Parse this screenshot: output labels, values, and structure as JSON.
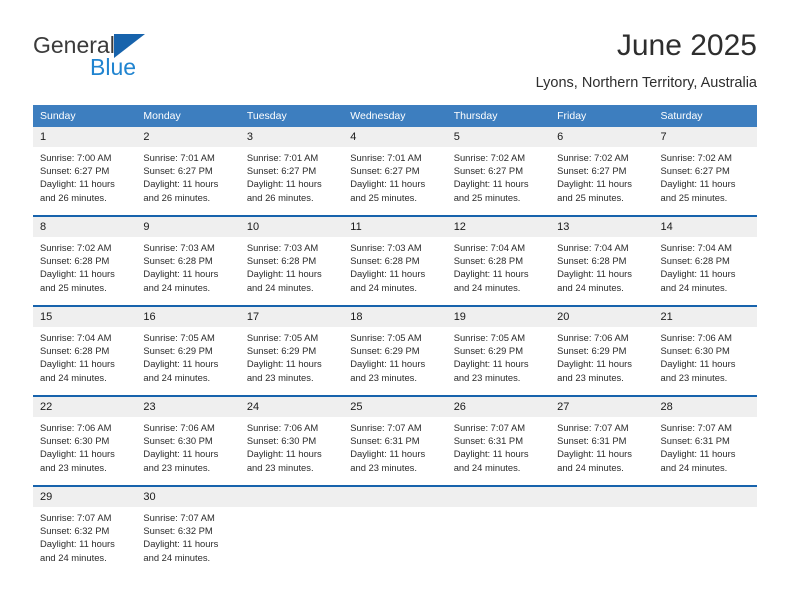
{
  "brand": {
    "name_part1": "General",
    "name_part2": "Blue",
    "logo_icon": "blue-triangle-logo",
    "color_primary": "#1763ac",
    "color_secondary": "#2084d0"
  },
  "header": {
    "title": "June 2025",
    "location": "Lyons, Northern Territory, Australia"
  },
  "calendar": {
    "header_bg": "#3d7ebf",
    "separator_color": "#1763ac",
    "daynum_bg": "#efefef",
    "weekdays": [
      "Sunday",
      "Monday",
      "Tuesday",
      "Wednesday",
      "Thursday",
      "Friday",
      "Saturday"
    ],
    "weeks": [
      [
        {
          "day": "1",
          "sunrise": "Sunrise: 7:00 AM",
          "sunset": "Sunset: 6:27 PM",
          "daylight_line1": "Daylight: 11 hours",
          "daylight_line2": "and 26 minutes."
        },
        {
          "day": "2",
          "sunrise": "Sunrise: 7:01 AM",
          "sunset": "Sunset: 6:27 PM",
          "daylight_line1": "Daylight: 11 hours",
          "daylight_line2": "and 26 minutes."
        },
        {
          "day": "3",
          "sunrise": "Sunrise: 7:01 AM",
          "sunset": "Sunset: 6:27 PM",
          "daylight_line1": "Daylight: 11 hours",
          "daylight_line2": "and 26 minutes."
        },
        {
          "day": "4",
          "sunrise": "Sunrise: 7:01 AM",
          "sunset": "Sunset: 6:27 PM",
          "daylight_line1": "Daylight: 11 hours",
          "daylight_line2": "and 25 minutes."
        },
        {
          "day": "5",
          "sunrise": "Sunrise: 7:02 AM",
          "sunset": "Sunset: 6:27 PM",
          "daylight_line1": "Daylight: 11 hours",
          "daylight_line2": "and 25 minutes."
        },
        {
          "day": "6",
          "sunrise": "Sunrise: 7:02 AM",
          "sunset": "Sunset: 6:27 PM",
          "daylight_line1": "Daylight: 11 hours",
          "daylight_line2": "and 25 minutes."
        },
        {
          "day": "7",
          "sunrise": "Sunrise: 7:02 AM",
          "sunset": "Sunset: 6:27 PM",
          "daylight_line1": "Daylight: 11 hours",
          "daylight_line2": "and 25 minutes."
        }
      ],
      [
        {
          "day": "8",
          "sunrise": "Sunrise: 7:02 AM",
          "sunset": "Sunset: 6:28 PM",
          "daylight_line1": "Daylight: 11 hours",
          "daylight_line2": "and 25 minutes."
        },
        {
          "day": "9",
          "sunrise": "Sunrise: 7:03 AM",
          "sunset": "Sunset: 6:28 PM",
          "daylight_line1": "Daylight: 11 hours",
          "daylight_line2": "and 24 minutes."
        },
        {
          "day": "10",
          "sunrise": "Sunrise: 7:03 AM",
          "sunset": "Sunset: 6:28 PM",
          "daylight_line1": "Daylight: 11 hours",
          "daylight_line2": "and 24 minutes."
        },
        {
          "day": "11",
          "sunrise": "Sunrise: 7:03 AM",
          "sunset": "Sunset: 6:28 PM",
          "daylight_line1": "Daylight: 11 hours",
          "daylight_line2": "and 24 minutes."
        },
        {
          "day": "12",
          "sunrise": "Sunrise: 7:04 AM",
          "sunset": "Sunset: 6:28 PM",
          "daylight_line1": "Daylight: 11 hours",
          "daylight_line2": "and 24 minutes."
        },
        {
          "day": "13",
          "sunrise": "Sunrise: 7:04 AM",
          "sunset": "Sunset: 6:28 PM",
          "daylight_line1": "Daylight: 11 hours",
          "daylight_line2": "and 24 minutes."
        },
        {
          "day": "14",
          "sunrise": "Sunrise: 7:04 AM",
          "sunset": "Sunset: 6:28 PM",
          "daylight_line1": "Daylight: 11 hours",
          "daylight_line2": "and 24 minutes."
        }
      ],
      [
        {
          "day": "15",
          "sunrise": "Sunrise: 7:04 AM",
          "sunset": "Sunset: 6:28 PM",
          "daylight_line1": "Daylight: 11 hours",
          "daylight_line2": "and 24 minutes."
        },
        {
          "day": "16",
          "sunrise": "Sunrise: 7:05 AM",
          "sunset": "Sunset: 6:29 PM",
          "daylight_line1": "Daylight: 11 hours",
          "daylight_line2": "and 24 minutes."
        },
        {
          "day": "17",
          "sunrise": "Sunrise: 7:05 AM",
          "sunset": "Sunset: 6:29 PM",
          "daylight_line1": "Daylight: 11 hours",
          "daylight_line2": "and 23 minutes."
        },
        {
          "day": "18",
          "sunrise": "Sunrise: 7:05 AM",
          "sunset": "Sunset: 6:29 PM",
          "daylight_line1": "Daylight: 11 hours",
          "daylight_line2": "and 23 minutes."
        },
        {
          "day": "19",
          "sunrise": "Sunrise: 7:05 AM",
          "sunset": "Sunset: 6:29 PM",
          "daylight_line1": "Daylight: 11 hours",
          "daylight_line2": "and 23 minutes."
        },
        {
          "day": "20",
          "sunrise": "Sunrise: 7:06 AM",
          "sunset": "Sunset: 6:29 PM",
          "daylight_line1": "Daylight: 11 hours",
          "daylight_line2": "and 23 minutes."
        },
        {
          "day": "21",
          "sunrise": "Sunrise: 7:06 AM",
          "sunset": "Sunset: 6:30 PM",
          "daylight_line1": "Daylight: 11 hours",
          "daylight_line2": "and 23 minutes."
        }
      ],
      [
        {
          "day": "22",
          "sunrise": "Sunrise: 7:06 AM",
          "sunset": "Sunset: 6:30 PM",
          "daylight_line1": "Daylight: 11 hours",
          "daylight_line2": "and 23 minutes."
        },
        {
          "day": "23",
          "sunrise": "Sunrise: 7:06 AM",
          "sunset": "Sunset: 6:30 PM",
          "daylight_line1": "Daylight: 11 hours",
          "daylight_line2": "and 23 minutes."
        },
        {
          "day": "24",
          "sunrise": "Sunrise: 7:06 AM",
          "sunset": "Sunset: 6:30 PM",
          "daylight_line1": "Daylight: 11 hours",
          "daylight_line2": "and 23 minutes."
        },
        {
          "day": "25",
          "sunrise": "Sunrise: 7:07 AM",
          "sunset": "Sunset: 6:31 PM",
          "daylight_line1": "Daylight: 11 hours",
          "daylight_line2": "and 23 minutes."
        },
        {
          "day": "26",
          "sunrise": "Sunrise: 7:07 AM",
          "sunset": "Sunset: 6:31 PM",
          "daylight_line1": "Daylight: 11 hours",
          "daylight_line2": "and 24 minutes."
        },
        {
          "day": "27",
          "sunrise": "Sunrise: 7:07 AM",
          "sunset": "Sunset: 6:31 PM",
          "daylight_line1": "Daylight: 11 hours",
          "daylight_line2": "and 24 minutes."
        },
        {
          "day": "28",
          "sunrise": "Sunrise: 7:07 AM",
          "sunset": "Sunset: 6:31 PM",
          "daylight_line1": "Daylight: 11 hours",
          "daylight_line2": "and 24 minutes."
        }
      ],
      [
        {
          "day": "29",
          "sunrise": "Sunrise: 7:07 AM",
          "sunset": "Sunset: 6:32 PM",
          "daylight_line1": "Daylight: 11 hours",
          "daylight_line2": "and 24 minutes."
        },
        {
          "day": "30",
          "sunrise": "Sunrise: 7:07 AM",
          "sunset": "Sunset: 6:32 PM",
          "daylight_line1": "Daylight: 11 hours",
          "daylight_line2": "and 24 minutes."
        },
        {
          "day": "",
          "sunrise": "",
          "sunset": "",
          "daylight_line1": "",
          "daylight_line2": ""
        },
        {
          "day": "",
          "sunrise": "",
          "sunset": "",
          "daylight_line1": "",
          "daylight_line2": ""
        },
        {
          "day": "",
          "sunrise": "",
          "sunset": "",
          "daylight_line1": "",
          "daylight_line2": ""
        },
        {
          "day": "",
          "sunrise": "",
          "sunset": "",
          "daylight_line1": "",
          "daylight_line2": ""
        },
        {
          "day": "",
          "sunrise": "",
          "sunset": "",
          "daylight_line1": "",
          "daylight_line2": ""
        }
      ]
    ]
  }
}
